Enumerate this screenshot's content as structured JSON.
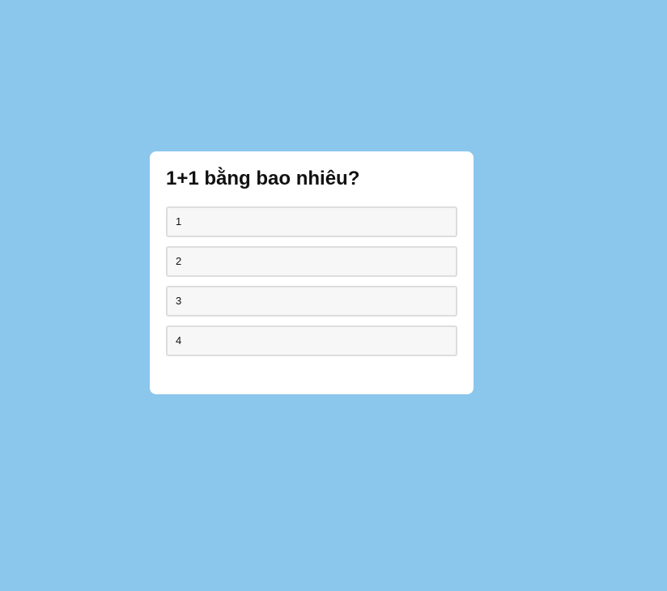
{
  "page": {
    "background_color": "#8bc6ec"
  },
  "quiz": {
    "question": "1+1 bằng bao nhiêu?",
    "options": [
      {
        "label": "1"
      },
      {
        "label": "2"
      },
      {
        "label": "3"
      },
      {
        "label": "4"
      }
    ]
  }
}
